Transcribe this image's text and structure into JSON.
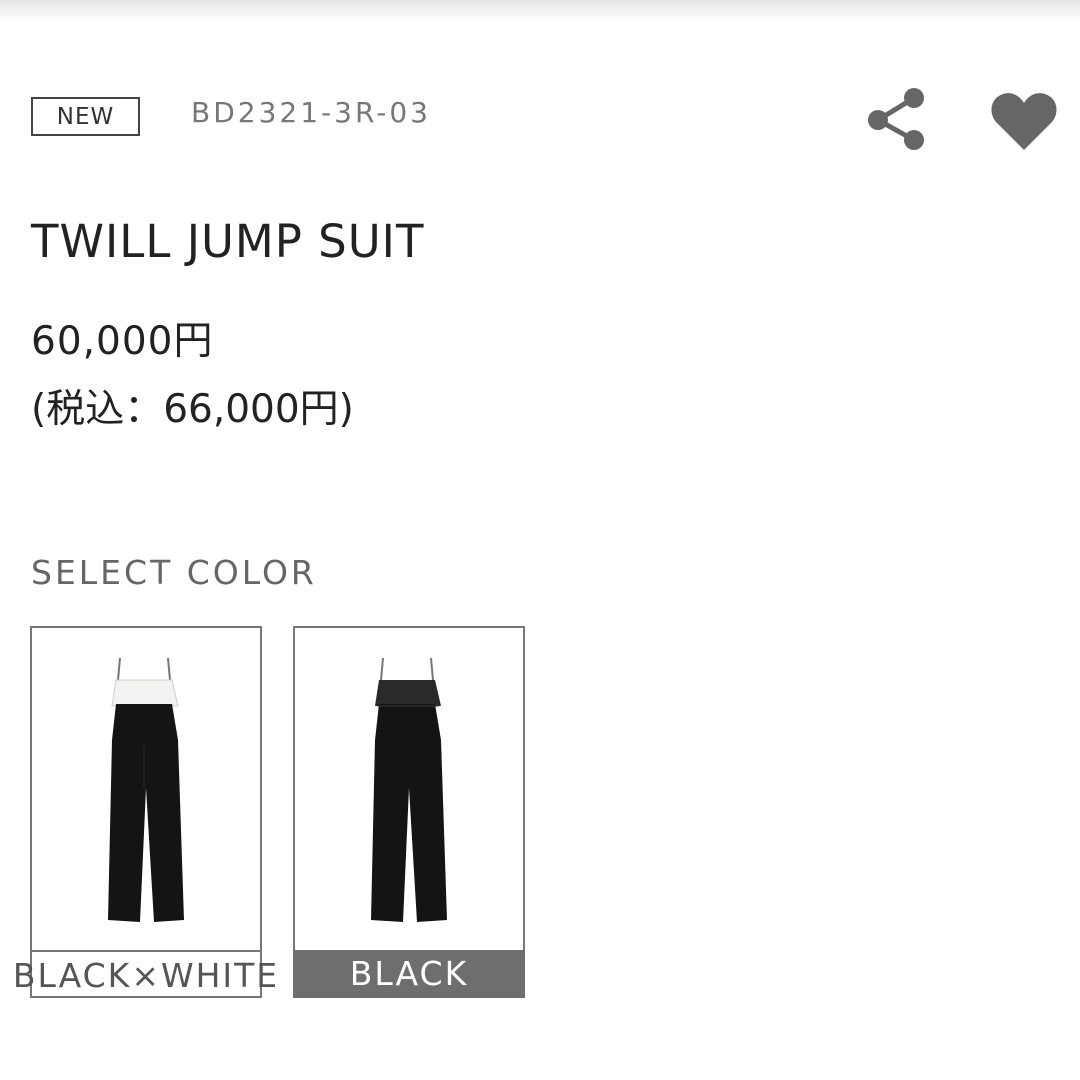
{
  "product": {
    "badge": "NEW",
    "sku": "BD2321-3R-03",
    "title": "TWILL JUMP SUIT",
    "price": "60,000円",
    "price_tax": "(税込：66,000円)"
  },
  "actions": {
    "share_icon": "share-icon",
    "favorite_icon": "heart-icon"
  },
  "colors": {
    "label": "SELECT COLOR",
    "options": [
      {
        "name": "BLACK×WHITE",
        "selected": false
      },
      {
        "name": "BLACK",
        "selected": true
      }
    ]
  },
  "theme": {
    "text": "#222222",
    "muted": "#777777",
    "selected_bg": "#6e6e6e",
    "icon": "#666666"
  }
}
